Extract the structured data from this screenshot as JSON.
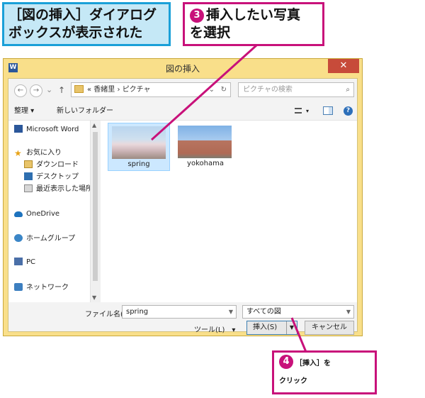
{
  "callouts": {
    "dialog_shown": "［図の挿入］ダイアログボックスが表示された",
    "dialog_shown_line1": "［図の挿入］ダイアログ",
    "dialog_shown_line2": "ボックスが表示された",
    "step3_num": "3",
    "step3_line1": "挿入したい写真",
    "step3_line2": "を選択",
    "step4_num": "4",
    "step4_line1": "［挿入］を",
    "step4_line2": "クリック"
  },
  "dialog": {
    "title": "図の挿入",
    "close": "✕",
    "address": {
      "crumbs": "« 香緒里 › ピクチャ",
      "dropdown": "⌄",
      "refresh": "↻"
    },
    "search": {
      "placeholder": "ピクチャの検索",
      "icon": "search-icon"
    },
    "toolbar": {
      "organize": "整理 ▾",
      "new_folder": "新しいフォルダー"
    },
    "nav_items": [
      {
        "label": "Microsoft Word",
        "icon": "word-icon"
      },
      {
        "label": "お気に入り",
        "icon": "star-icon"
      },
      {
        "label": "ダウンロード",
        "icon": "download-folder-icon"
      },
      {
        "label": "デスクトップ",
        "icon": "desktop-icon"
      },
      {
        "label": "最近表示した場所",
        "icon": "recent-places-icon"
      },
      {
        "label": "OneDrive",
        "icon": "onedrive-icon"
      },
      {
        "label": "ホームグループ",
        "icon": "homegroup-icon"
      },
      {
        "label": "PC",
        "icon": "pc-icon"
      },
      {
        "label": "ネットワーク",
        "icon": "network-icon"
      }
    ],
    "files": [
      {
        "name": "spring",
        "selected": true
      },
      {
        "name": "yokohama",
        "selected": false
      }
    ],
    "filename_label": "ファイル名(N):",
    "filename_value": "spring",
    "file_type": "すべての図",
    "tools_label": "ツール(L)　▾",
    "insert_label": "挿入(S)",
    "cancel_label": "キャンセル"
  },
  "colors": {
    "blue_callout_bg": "#c5e8f6",
    "blue_callout_border": "#1aa0d8",
    "pink_accent": "#c8117a",
    "window_frame": "#f9df8a",
    "close_button": "#c74b3a",
    "selection": "#cce8ff"
  }
}
